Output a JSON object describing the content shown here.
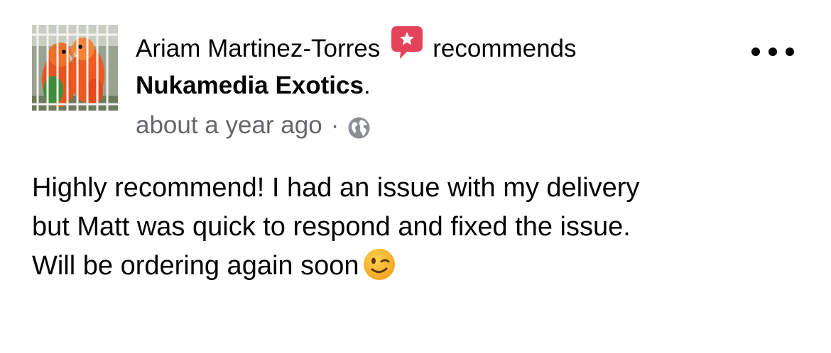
{
  "post": {
    "author_name": "Ariam Martinez-Torres",
    "action_text": "recommends",
    "page_name": "Nukamedia Exotics",
    "page_suffix": ".",
    "timestamp": "about a year ago",
    "separator": "·",
    "privacy_icon": "globe-icon",
    "recommend_icon": "recommend-star-icon",
    "more_icon": "ellipsis-icon",
    "body_lines": [
      "Highly recommend! I had an issue with my delivery",
      "but Matt was quick to respond and fixed the issue.",
      "Will be ordering again soon"
    ],
    "body_emoji": "winking-face-emoji",
    "colors": {
      "recommend_badge": "#e5435a",
      "secondary_text": "#65676b",
      "primary_text": "#050505"
    }
  }
}
